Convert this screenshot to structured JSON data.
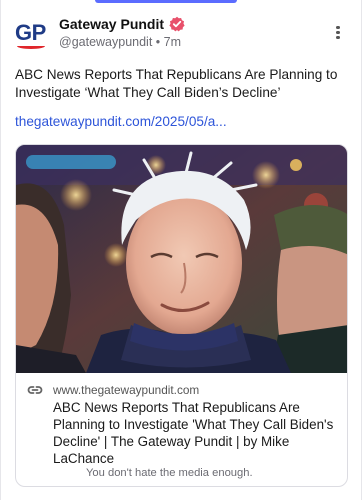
{
  "account": {
    "display_name": "Gateway Pundit",
    "handle": "@gatewaypundit",
    "separator": "•",
    "time_ago": "7m",
    "logo_text": "GP"
  },
  "post": {
    "text": "ABC News Reports That Republicans Are Planning to Investigate ‘What They Call Biden’s Decline’",
    "link": "thegatewaypundit.com/2025/05/a..."
  },
  "card": {
    "domain": "www.thegatewaypundit.com",
    "title": "ABC News Reports That Republicans Are Planning to Investigate 'What They Call Biden's Decline' | The Gateway Pundit | by Mike LaChance",
    "description": "You don't hate the media enough."
  },
  "colors": {
    "accent": "#5b6cff",
    "link": "#2e55d9",
    "verified_badge": "#e8506b",
    "logo_blue": "#1f3b86",
    "logo_red": "#e0262b"
  },
  "icons": {
    "verified": "verified-badge-icon",
    "more": "more-vertical-icon",
    "link": "link-icon"
  }
}
